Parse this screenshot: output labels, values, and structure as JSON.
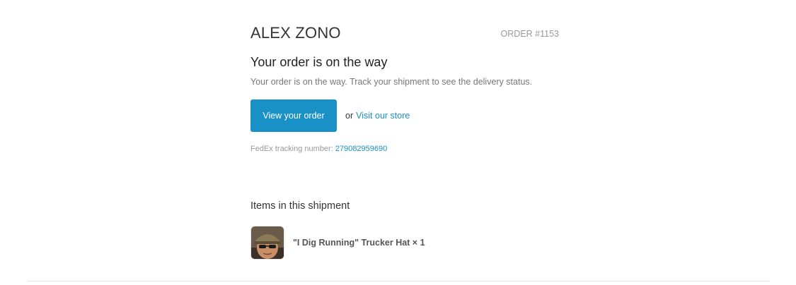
{
  "shop": {
    "name": "ALEX ZONO",
    "order_number": "ORDER #1153"
  },
  "main": {
    "heading": "Your order is on the way",
    "subtext": "Your order is on the way. Track your shipment to see the delivery status.",
    "view_order_label": "View your order",
    "or_text": "or",
    "visit_store_label": "Visit our store",
    "tracking_label": "FedEx tracking number:",
    "tracking_number": "279082959690"
  },
  "shipment": {
    "heading": "Items in this shipment",
    "items": [
      {
        "title": "\"I Dig Running\" Trucker Hat × 1",
        "thumbnail": "product-photo"
      }
    ]
  },
  "colors": {
    "accent": "#1990c6",
    "muted_text": "#999999",
    "body_text": "#333333"
  }
}
